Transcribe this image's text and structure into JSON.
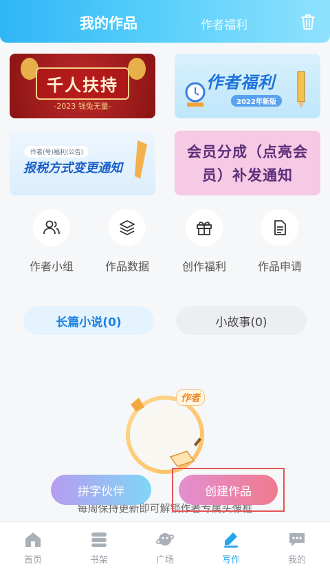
{
  "header": {
    "active_tab": "我的作品",
    "inactive_tab": "作者福利",
    "trash_icon": "trash-icon"
  },
  "banners": [
    {
      "main": "千人扶持",
      "sub": "-2023 钱兔无量-"
    },
    {
      "main": "作者福利",
      "sub": "2022年新版"
    },
    {
      "small": "作者(号)福利(公告)",
      "main": "报税方式变更通知"
    },
    {
      "main_line1": "会员分成（点亮会",
      "main_line2": "员）补发通知"
    }
  ],
  "quick_actions": [
    {
      "label": "作者小组",
      "icon": "users-icon"
    },
    {
      "label": "作品数据",
      "icon": "layers-icon"
    },
    {
      "label": "创作福利",
      "icon": "gift-icon"
    },
    {
      "label": "作品申请",
      "icon": "document-icon"
    }
  ],
  "categories": {
    "active": "长篇小说(0)",
    "inactive": "小故事(0)"
  },
  "illustration": {
    "badge": "作者"
  },
  "actions": {
    "partner_button": "拼字伙伴",
    "create_button": "创建作品",
    "hint": "每周保持更新即可解锁作者专属头像框"
  },
  "nav": [
    {
      "label": "首页",
      "icon": "home-icon"
    },
    {
      "label": "书架",
      "icon": "bookshelf-icon"
    },
    {
      "label": "广场",
      "icon": "planet-icon"
    },
    {
      "label": "写作",
      "icon": "pen-icon",
      "active": true
    },
    {
      "label": "我的",
      "icon": "chat-icon"
    }
  ],
  "colors": {
    "accent": "#27a6f0",
    "header_start": "#2fb6f6",
    "highlight": "#e25555"
  }
}
